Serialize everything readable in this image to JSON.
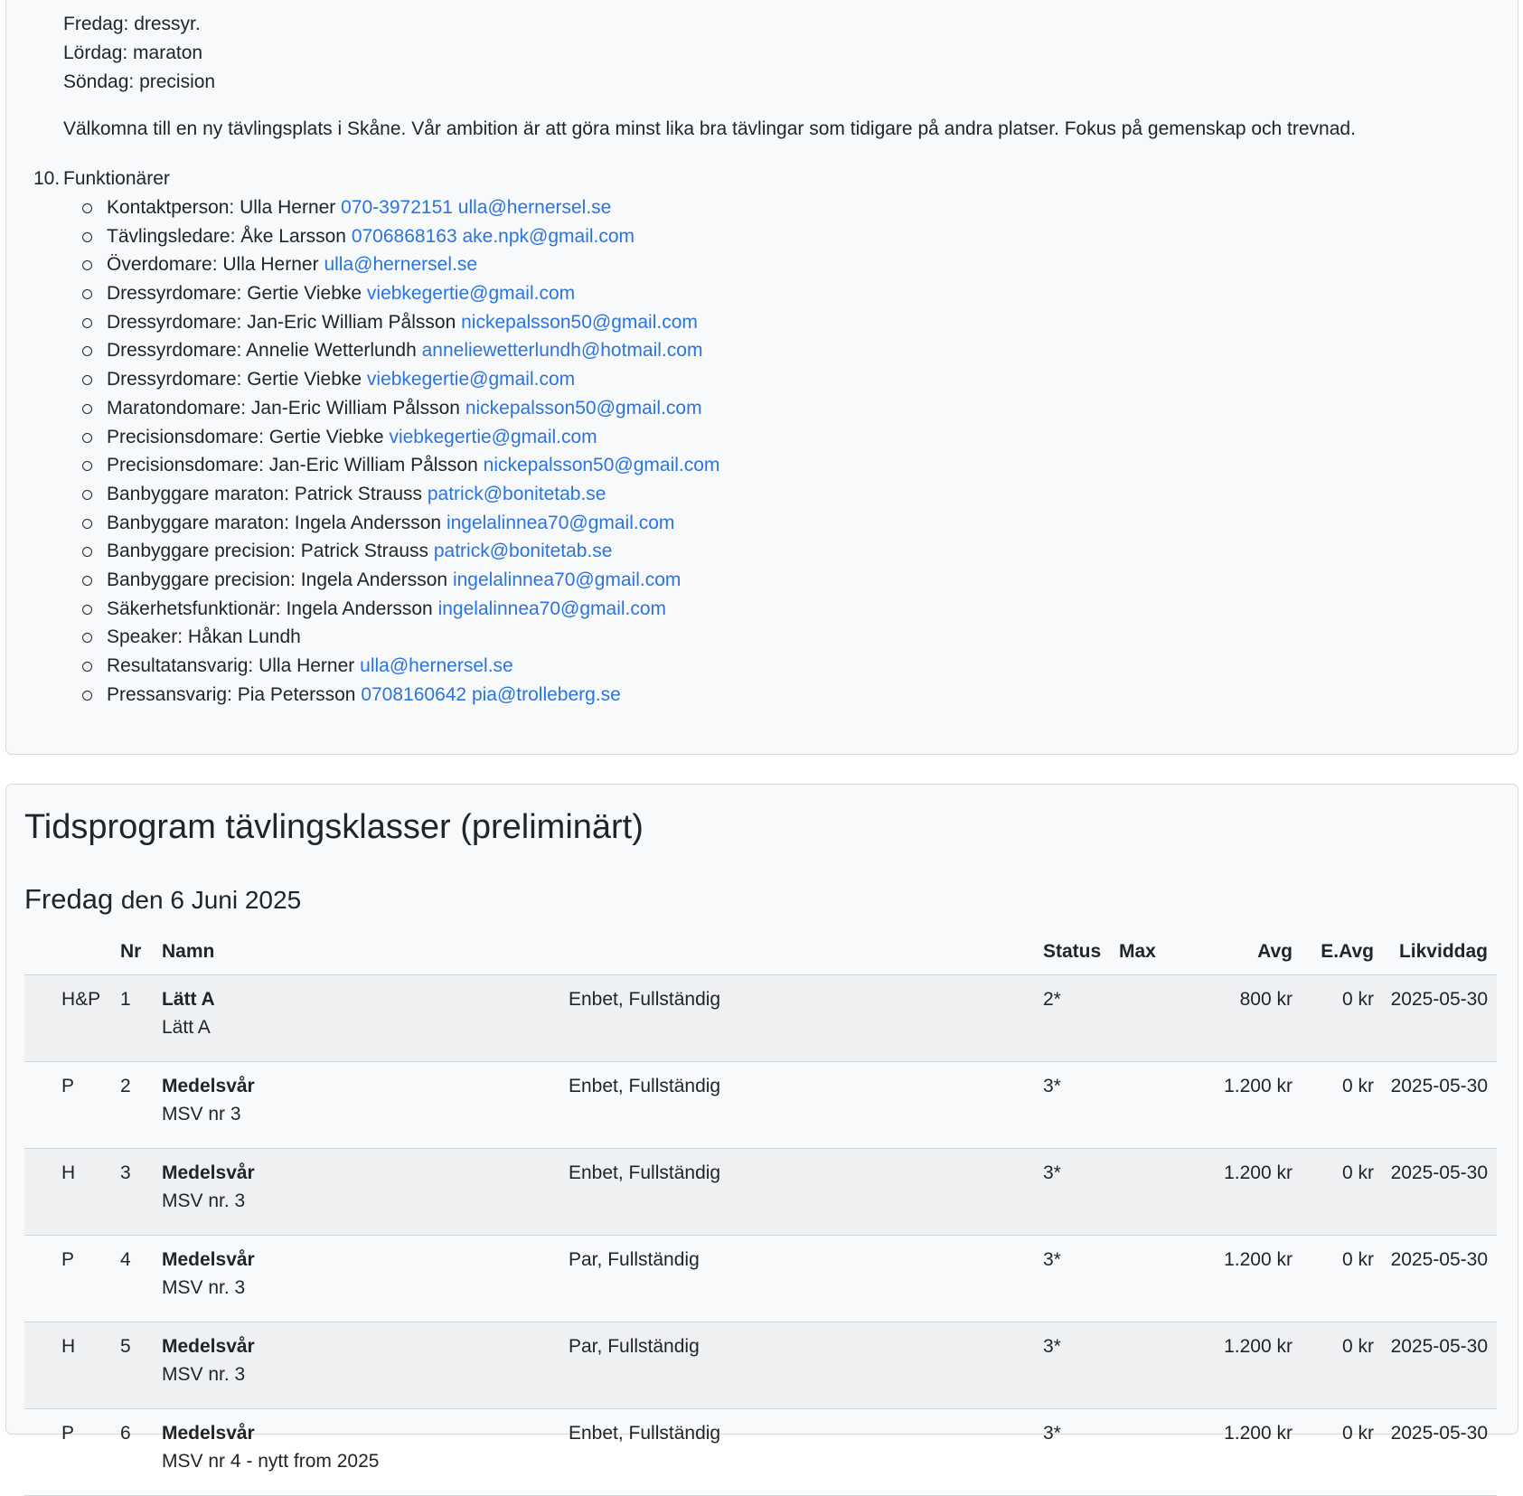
{
  "info": {
    "days": [
      "Fredag: dressyr.",
      "Lördag: maraton",
      "Söndag: precision"
    ],
    "welcome": "Välkomna till en ny tävlingsplats i Skåne. Vår ambition är att göra minst lika bra tävlingar som tidigare på andra platser. Fokus på gemenskap och trevnad.",
    "officials_number": "10.",
    "officials_title": "Funktionärer",
    "officials": [
      {
        "role": "Kontaktperson: Ulla Herner",
        "phone": "070-3972151",
        "email": "ulla@hernersel.se"
      },
      {
        "role": "Tävlingsledare: Åke Larsson",
        "phone": "0706868163",
        "email": "ake.npk@gmail.com"
      },
      {
        "role": "Överdomare: Ulla Herner",
        "phone": "",
        "email": "ulla@hernersel.se"
      },
      {
        "role": "Dressyrdomare: Gertie Viebke",
        "phone": "",
        "email": "viebkegertie@gmail.com"
      },
      {
        "role": "Dressyrdomare: Jan-Eric William Pålsson",
        "phone": "",
        "email": "nickepalsson50@gmail.com"
      },
      {
        "role": "Dressyrdomare: Annelie Wetterlundh",
        "phone": "",
        "email": "anneliewetterlundh@hotmail.com"
      },
      {
        "role": "Dressyrdomare: Gertie Viebke",
        "phone": "",
        "email": "viebkegertie@gmail.com"
      },
      {
        "role": "Maratondomare: Jan-Eric William Pålsson",
        "phone": "",
        "email": "nickepalsson50@gmail.com"
      },
      {
        "role": "Precisionsdomare: Gertie Viebke",
        "phone": "",
        "email": "viebkegertie@gmail.com"
      },
      {
        "role": "Precisionsdomare: Jan-Eric William Pålsson",
        "phone": "",
        "email": "nickepalsson50@gmail.com"
      },
      {
        "role": "Banbyggare maraton: Patrick Strauss",
        "phone": "",
        "email": "patrick@bonitetab.se"
      },
      {
        "role": "Banbyggare maraton: Ingela Andersson",
        "phone": "",
        "email": "ingelalinnea70@gmail.com"
      },
      {
        "role": "Banbyggare precision: Patrick Strauss",
        "phone": "",
        "email": "patrick@bonitetab.se"
      },
      {
        "role": "Banbyggare precision: Ingela Andersson",
        "phone": "",
        "email": "ingelalinnea70@gmail.com"
      },
      {
        "role": "Säkerhetsfunktionär: Ingela Andersson",
        "phone": "",
        "email": "ingelalinnea70@gmail.com"
      },
      {
        "role": "Speaker: Håkan Lundh",
        "phone": "",
        "email": ""
      },
      {
        "role": "Resultatansvarig: Ulla Herner",
        "phone": "",
        "email": "ulla@hernersel.se"
      },
      {
        "role": "Pressansvarig: Pia Petersson",
        "phone": "0708160642",
        "email": "pia@trolleberg.se"
      }
    ]
  },
  "schedule": {
    "title": "Tidsprogram tävlingsklasser (preliminärt)",
    "day_main": "Fredag",
    "day_sub": "den 6 Juni 2025",
    "headers": {
      "type": "",
      "nr": "Nr",
      "name": "Namn",
      "class": "",
      "status": "Status",
      "max": "Max",
      "avg": "Avg",
      "eavg": "E.Avg",
      "likviddag": "Likviddag"
    },
    "rows": [
      {
        "type": "H&P",
        "nr": "1",
        "name": "Lätt A",
        "subname": "Lätt A",
        "class": "Enbet, Fullständig",
        "status": "2*",
        "max": "",
        "avg": "800 kr",
        "eavg": "0 kr",
        "likviddag": "2025-05-30"
      },
      {
        "type": "P",
        "nr": "2",
        "name": "Medelsvår",
        "subname": "MSV nr 3",
        "class": "Enbet, Fullständig",
        "status": "3*",
        "max": "",
        "avg": "1.200 kr",
        "eavg": "0 kr",
        "likviddag": "2025-05-30"
      },
      {
        "type": "H",
        "nr": "3",
        "name": "Medelsvår",
        "subname": "MSV nr. 3",
        "class": "Enbet, Fullständig",
        "status": "3*",
        "max": "",
        "avg": "1.200 kr",
        "eavg": "0 kr",
        "likviddag": "2025-05-30"
      },
      {
        "type": "P",
        "nr": "4",
        "name": "Medelsvår",
        "subname": "MSV nr. 3",
        "class": "Par, Fullständig",
        "status": "3*",
        "max": "",
        "avg": "1.200 kr",
        "eavg": "0 kr",
        "likviddag": "2025-05-30"
      },
      {
        "type": "H",
        "nr": "5",
        "name": "Medelsvår",
        "subname": "MSV nr. 3",
        "class": "Par, Fullständig",
        "status": "3*",
        "max": "",
        "avg": "1.200 kr",
        "eavg": "0 kr",
        "likviddag": "2025-05-30"
      },
      {
        "type": "P",
        "nr": "6",
        "name": "Medelsvår",
        "subname": "MSV nr 4 - nytt from 2025",
        "class": "Enbet, Fullständig",
        "status": "3*",
        "max": "",
        "avg": "1.200 kr",
        "eavg": "0 kr",
        "likviddag": "2025-05-30"
      }
    ]
  }
}
